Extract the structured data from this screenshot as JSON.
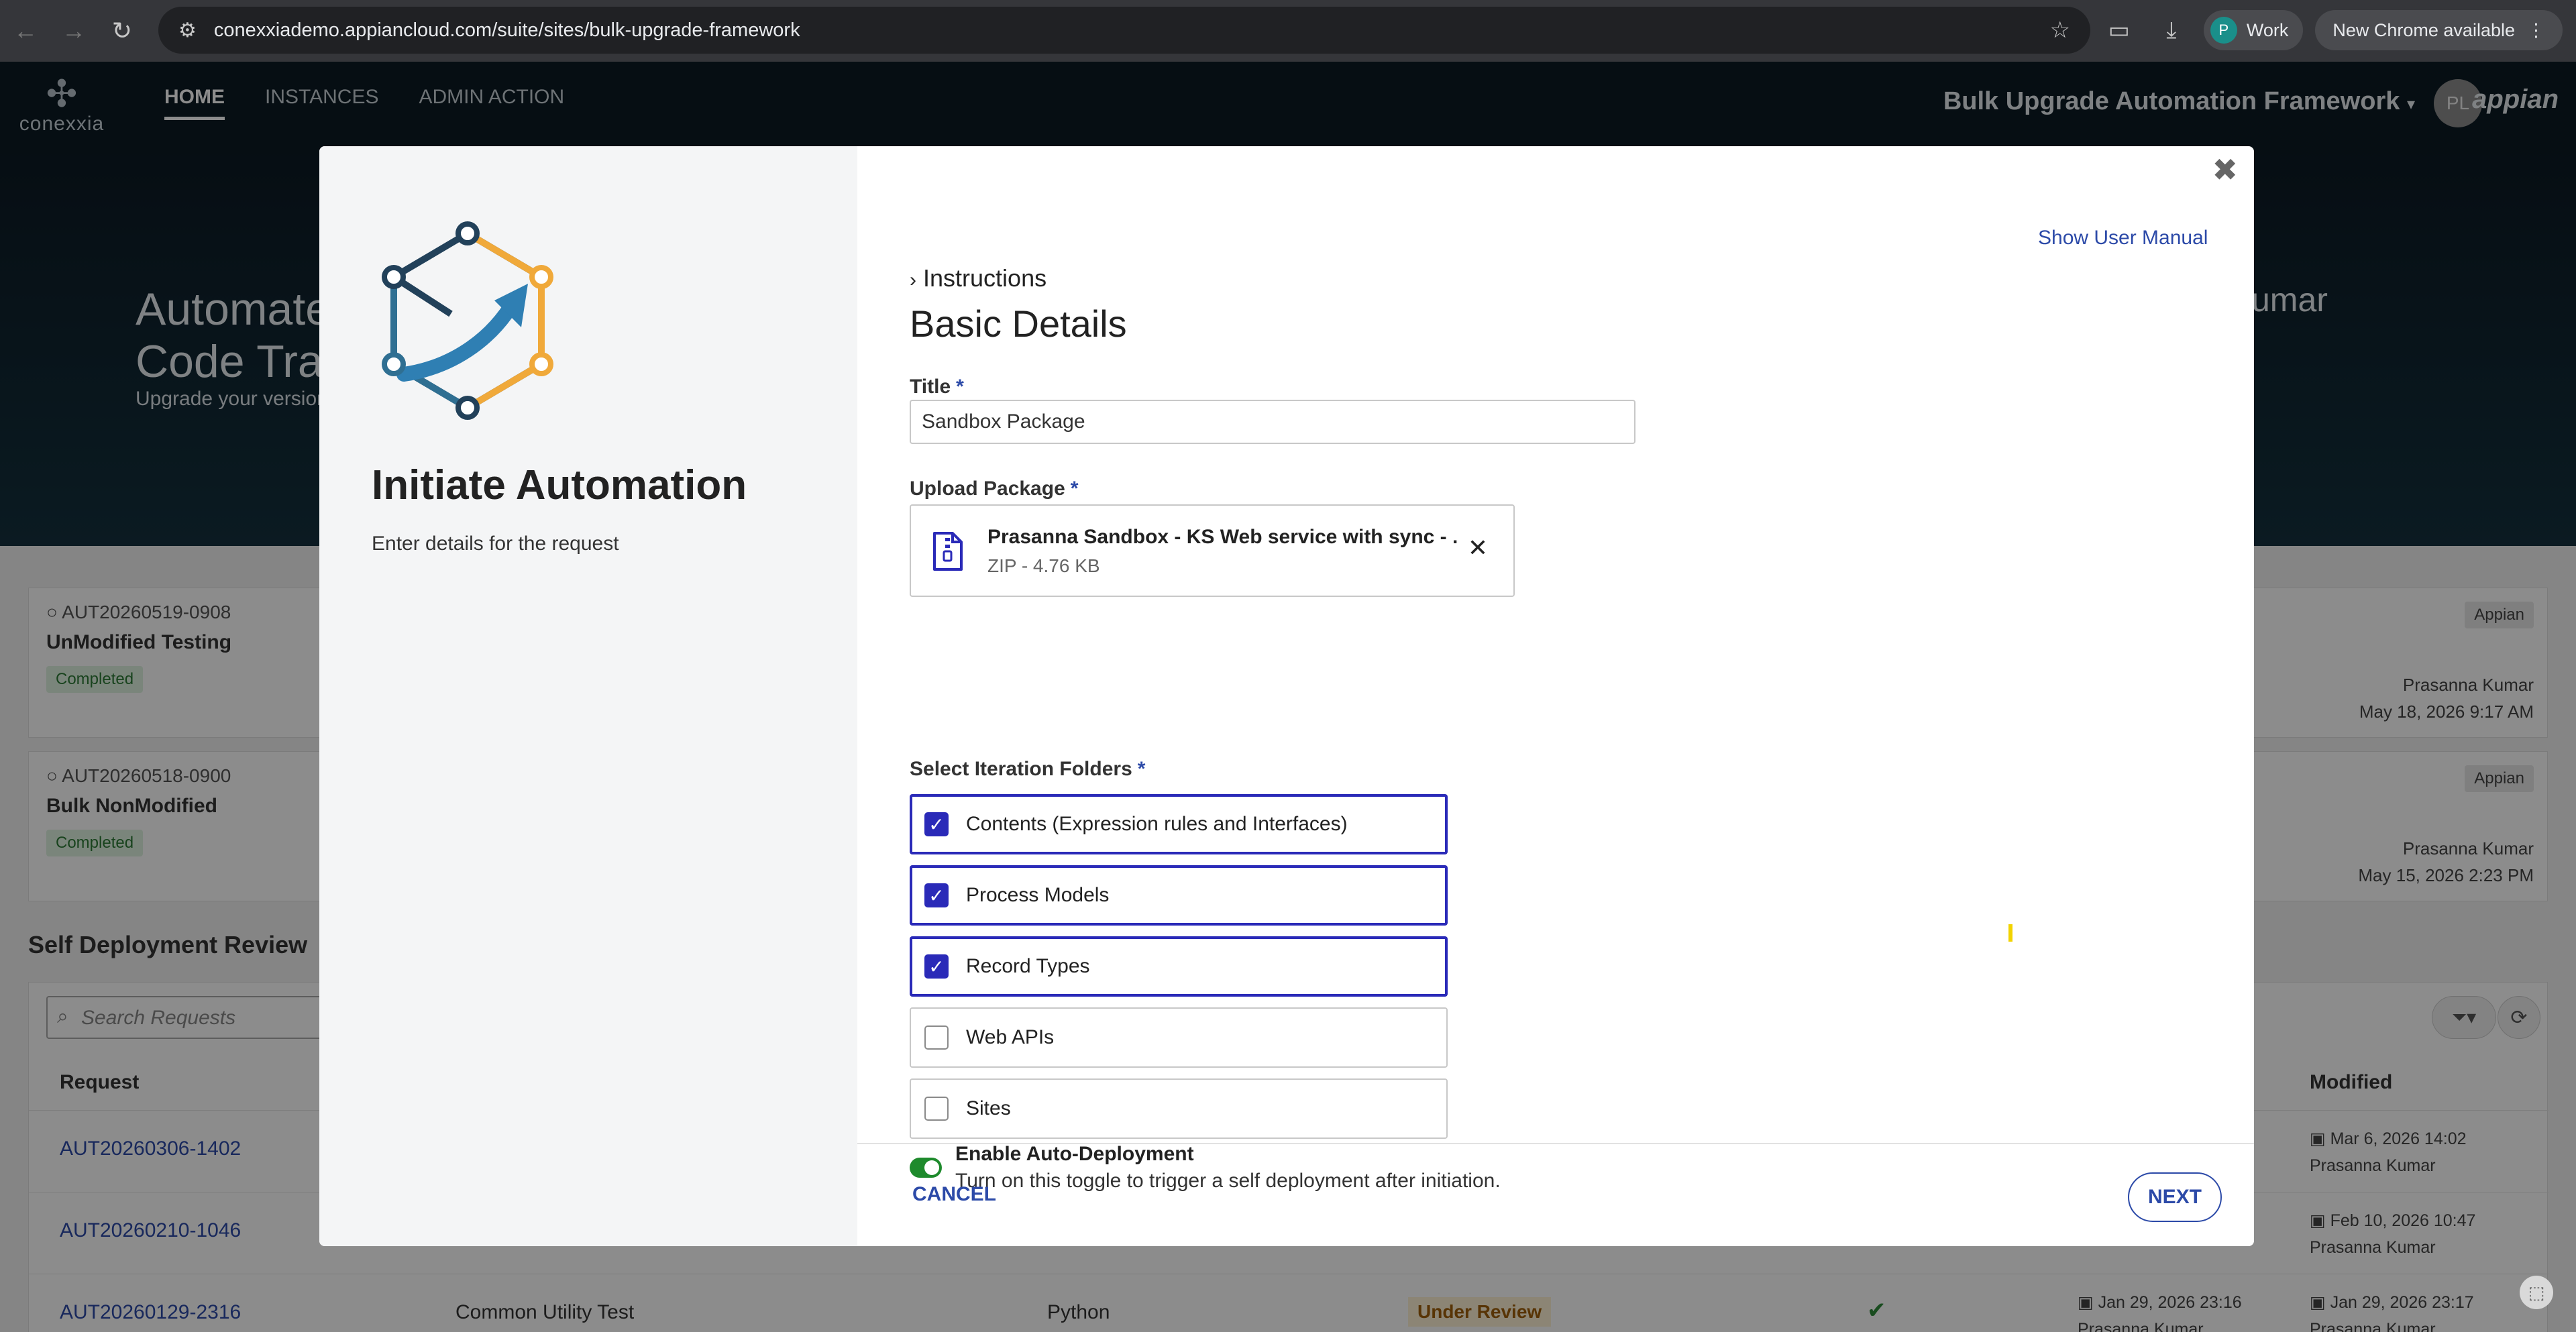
{
  "browser": {
    "url": "conexxiademo.appiancloud.com/suite/sites/bulk-upgrade-framework",
    "profile_initial": "P",
    "profile_label": "Work",
    "update_label": "New Chrome available"
  },
  "header": {
    "logo_text": "conexxia",
    "nav": [
      "HOME",
      "INSTANCES",
      "ADMIN ACTION"
    ],
    "app_title": "Bulk Upgrade Automation Framework",
    "avatar_initials": "PL",
    "brand": "appian"
  },
  "background": {
    "hero_title_line1": "Automate",
    "hero_title_line2": "Code Tra",
    "hero_sub": "Upgrade your version",
    "hero_right": "umar",
    "cards": [
      {
        "id": "AUT20260519-0908",
        "name": "UnModified Testing",
        "status": "Completed",
        "tag": "Appian",
        "who": "Prasanna Kumar",
        "when": "May 18, 2026 9:17 AM"
      },
      {
        "id": "AUT20260518-0900",
        "name": "Bulk NonModified",
        "status": "Completed",
        "tag": "Appian",
        "who": "Prasanna Kumar",
        "when": "May 15, 2026 2:23 PM"
      }
    ],
    "section_title": "Self Deployment Review",
    "search_placeholder": "Search Requests",
    "col_request": "Request",
    "col_modified": "Modified",
    "rows": [
      {
        "id": "AUT20260306-1402",
        "modified": "Mar 6, 2026 14:02",
        "by": "Prasanna Kumar"
      },
      {
        "id": "AUT20260210-1046",
        "modified": "Feb 10, 2026 10:47",
        "by": "Prasanna Kumar"
      },
      {
        "id": "AUT20260129-2316",
        "name": "Common Utility Test",
        "lang": "Python",
        "status": "Under Review",
        "created": "Jan 29, 2026 23:16",
        "modified": "Jan 29, 2026 23:17",
        "by": "Prasanna Kumar"
      }
    ]
  },
  "modal": {
    "left_title": "Initiate Automation",
    "left_sub": "Enter details for the request",
    "manual_link": "Show User Manual",
    "instructions": "Instructions",
    "section_title": "Basic Details",
    "title_label": "Title",
    "title_value": "Sandbox Package",
    "upload_label": "Upload Package",
    "file_name": "Prasanna Sandbox - KS Web service with sync - ...",
    "file_meta": "ZIP - 4.76 KB",
    "folders_label": "Select Iteration Folders",
    "folders": [
      {
        "label": "Contents (Expression rules and Interfaces)",
        "checked": true
      },
      {
        "label": "Process Models",
        "checked": true
      },
      {
        "label": "Record Types",
        "checked": true
      },
      {
        "label": "Web APIs",
        "checked": false
      },
      {
        "label": "Sites",
        "checked": false
      }
    ],
    "toggle_title": "Enable Auto-Deployment",
    "toggle_desc": "Turn on this toggle to trigger a self deployment after initiation.",
    "toggle_on": true,
    "cancel": "CANCEL",
    "next": "NEXT"
  },
  "colors": {
    "accent": "#2a2ab8",
    "link": "#2c4aa8",
    "toggle_on": "#1e8a2c",
    "header_bg": "#0c1a24"
  },
  "icons": [
    "back-arrow-icon",
    "forward-arrow-icon",
    "reload-icon",
    "site-info-icon",
    "star-icon",
    "screen-search-icon",
    "download-icon",
    "menu-dots-icon",
    "close-icon",
    "chevron-right-icon",
    "zip-file-icon",
    "remove-icon",
    "check-icon",
    "filter-icon",
    "refresh-icon",
    "search-icon",
    "calendar-icon"
  ]
}
